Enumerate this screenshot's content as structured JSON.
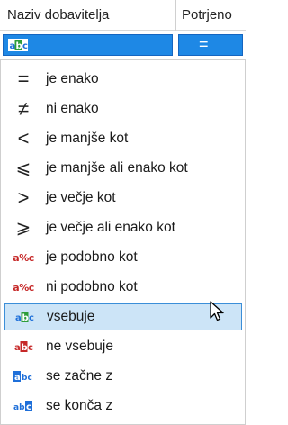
{
  "header": {
    "columns": [
      {
        "label": "Naziv dobavitelja"
      },
      {
        "label": "Potrjeno"
      }
    ]
  },
  "filter_row": {
    "col1_operator_icon": "contains-icon",
    "col2_operator_symbol": "="
  },
  "menu": {
    "highlighted_index": 8,
    "items": [
      {
        "label": "je enako",
        "icon": "equals-icon",
        "symbol": "="
      },
      {
        "label": "ni enako",
        "icon": "not-equals-icon",
        "symbol": "≠"
      },
      {
        "label": "je manjše kot",
        "icon": "less-than-icon",
        "symbol": "<"
      },
      {
        "label": "je manjše ali enako kot",
        "icon": "less-or-equal-icon",
        "symbol": "⩽"
      },
      {
        "label": "je večje kot",
        "icon": "greater-than-icon",
        "symbol": ">"
      },
      {
        "label": "je večje ali enako kot",
        "icon": "greater-or-equal-icon",
        "symbol": "⩾"
      },
      {
        "label": "je podobno kot",
        "icon": "like-icon",
        "symbol": "a%c"
      },
      {
        "label": "ni podobno kot",
        "icon": "not-like-icon",
        "symbol": "a%c"
      },
      {
        "label": "vsebuje",
        "icon": "contains-icon",
        "symbol": ""
      },
      {
        "label": "ne vsebuje",
        "icon": "not-contains-icon",
        "symbol": ""
      },
      {
        "label": "se začne z",
        "icon": "starts-with-icon",
        "symbol": ""
      },
      {
        "label": "se konča z",
        "icon": "ends-with-icon",
        "symbol": ""
      }
    ]
  },
  "colors": {
    "selection_blue": "#1e88e5",
    "highlight_bg": "#cce4f7",
    "highlight_border": "#3b8ed8",
    "icon_red": "#c62828",
    "icon_green": "#2e9d3a",
    "icon_blue": "#1e6fd9"
  }
}
